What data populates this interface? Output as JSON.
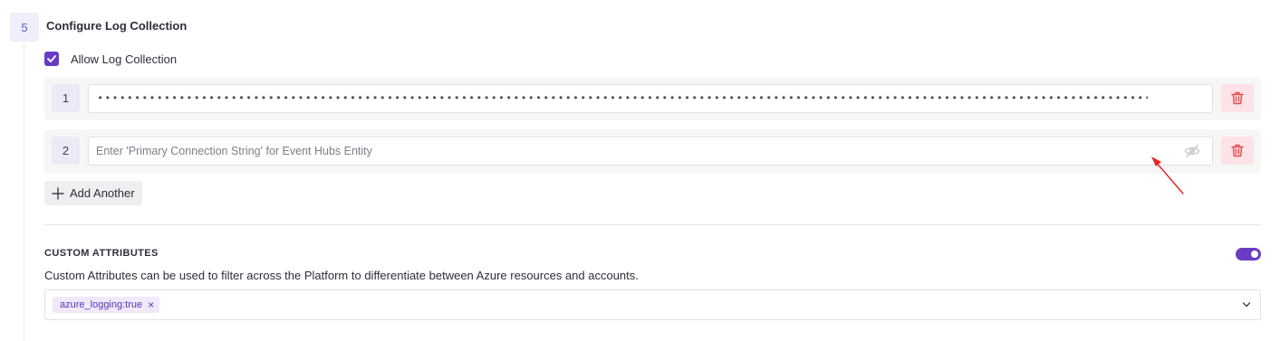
{
  "step": {
    "number": "5",
    "title": "Configure Log Collection"
  },
  "allow_log_collection": {
    "label": "Allow Log Collection",
    "checked": true
  },
  "connection_strings": [
    {
      "index": "1",
      "masked_value": "•••••••••••••••••••••••••••••••••••••••••••••••••••••••••••••••••••••••••••••••••••••••••••••••••••••••••••••••••••••••••••••••••••••••••••••••••••••••••••••••••••"
    },
    {
      "index": "2",
      "placeholder": "Enter 'Primary Connection String' for Event Hubs Entity"
    }
  ],
  "add_button": {
    "label": "Add Another"
  },
  "custom_attributes": {
    "heading": "CUSTOM ATTRIBUTES",
    "enabled": true,
    "description": "Custom Attributes can be used to filter across the Platform to differentiate between Azure resources and accounts.",
    "tags": [
      {
        "label": "azure_logging:true",
        "remove": "×"
      }
    ]
  },
  "icons": {
    "checkbox": "check-icon",
    "delete": "trash-icon",
    "visibility": "eye-off-icon",
    "add": "plus-icon",
    "dropdown": "chevron-down-icon"
  },
  "colors": {
    "accent": "#6a3cc4",
    "danger": "#e5484d",
    "danger_bg": "#fde3e5",
    "annotation": "#e8231c"
  }
}
